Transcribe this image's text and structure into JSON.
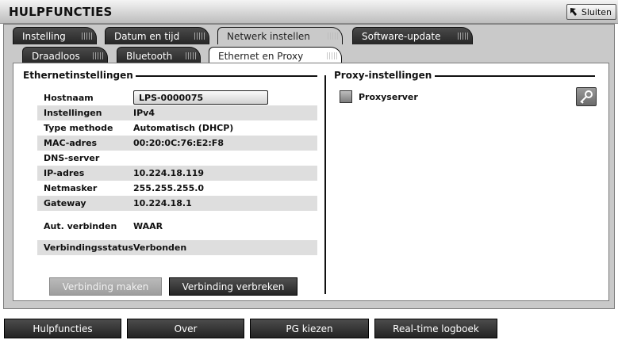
{
  "window": {
    "title": "HULPFUNCTIES",
    "close_label": "Sluiten"
  },
  "main_tabs": [
    {
      "label": "Instelling"
    },
    {
      "label": "Datum en tijd"
    },
    {
      "label": "Netwerk instellen",
      "selected": true
    },
    {
      "label": "Software-update"
    }
  ],
  "sub_tabs": [
    {
      "label": "Draadloos"
    },
    {
      "label": "Bluetooth"
    },
    {
      "label": "Ethernet en Proxy",
      "selected": true
    }
  ],
  "ethernet": {
    "title": "Ethernetinstellingen",
    "hostname_label": "Hostnaam",
    "hostname_value": "LPS-0000075",
    "rows": [
      {
        "label": "Instellingen",
        "value": "IPv4"
      },
      {
        "label": "Type methode",
        "value": "Automatisch (DHCP)"
      },
      {
        "label": "MAC-adres",
        "value": "00:20:0C:76:E2:F8"
      },
      {
        "label": "DNS-server",
        "value": ""
      },
      {
        "label": "IP-adres",
        "value": "10.224.18.119"
      },
      {
        "label": "Netmasker",
        "value": "255.255.255.0"
      },
      {
        "label": "Gateway",
        "value": "10.224.18.1"
      },
      {
        "label": "Aut. verbinden",
        "value": "WAAR"
      },
      {
        "label": "Verbindingsstatus",
        "value": "Verbonden"
      }
    ],
    "connect_button": "Verbinding maken",
    "disconnect_button": "Verbinding verbreken"
  },
  "proxy": {
    "title": "Proxy-instellingen",
    "server_label": "Proxyserver",
    "server_enabled": false
  },
  "bottom_nav": [
    {
      "label": "Hulpfuncties"
    },
    {
      "label": "Over"
    },
    {
      "label": "PG kiezen"
    },
    {
      "label": "Real-time logboek"
    }
  ]
}
